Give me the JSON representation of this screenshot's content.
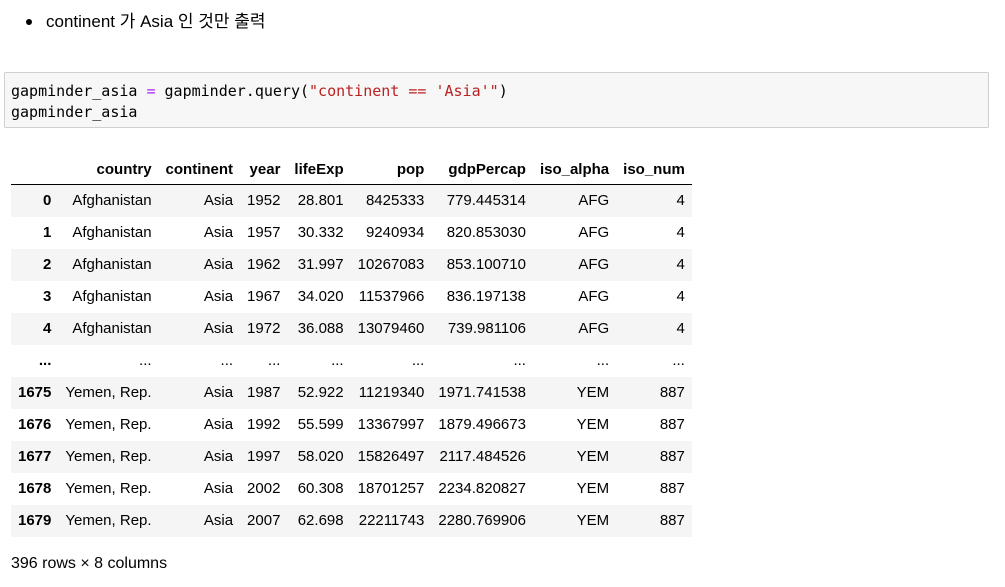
{
  "markdown": {
    "bullet": "continent 가 Asia 인 것만 출력"
  },
  "code_cell": {
    "line1_var": "gapminder_asia",
    "line1_op": " = ",
    "line1_call": "gapminder.query(",
    "line1_str": "\"continent == 'Asia'\"",
    "line1_close": ")",
    "line2": "gapminder_asia"
  },
  "table": {
    "columns": [
      "country",
      "continent",
      "year",
      "lifeExp",
      "pop",
      "gdpPercap",
      "iso_alpha",
      "iso_num"
    ],
    "rows": [
      {
        "index": "0",
        "cells": [
          "Afghanistan",
          "Asia",
          "1952",
          "28.801",
          "8425333",
          "779.445314",
          "AFG",
          "4"
        ]
      },
      {
        "index": "1",
        "cells": [
          "Afghanistan",
          "Asia",
          "1957",
          "30.332",
          "9240934",
          "820.853030",
          "AFG",
          "4"
        ]
      },
      {
        "index": "2",
        "cells": [
          "Afghanistan",
          "Asia",
          "1962",
          "31.997",
          "10267083",
          "853.100710",
          "AFG",
          "4"
        ]
      },
      {
        "index": "3",
        "cells": [
          "Afghanistan",
          "Asia",
          "1967",
          "34.020",
          "11537966",
          "836.197138",
          "AFG",
          "4"
        ]
      },
      {
        "index": "4",
        "cells": [
          "Afghanistan",
          "Asia",
          "1972",
          "36.088",
          "13079460",
          "739.981106",
          "AFG",
          "4"
        ]
      },
      {
        "index": "...",
        "cells": [
          "...",
          "...",
          "...",
          "...",
          "...",
          "...",
          "...",
          "..."
        ]
      },
      {
        "index": "1675",
        "cells": [
          "Yemen, Rep.",
          "Asia",
          "1987",
          "52.922",
          "11219340",
          "1971.741538",
          "YEM",
          "887"
        ]
      },
      {
        "index": "1676",
        "cells": [
          "Yemen, Rep.",
          "Asia",
          "1992",
          "55.599",
          "13367997",
          "1879.496673",
          "YEM",
          "887"
        ]
      },
      {
        "index": "1677",
        "cells": [
          "Yemen, Rep.",
          "Asia",
          "1997",
          "58.020",
          "15826497",
          "2117.484526",
          "YEM",
          "887"
        ]
      },
      {
        "index": "1678",
        "cells": [
          "Yemen, Rep.",
          "Asia",
          "2002",
          "60.308",
          "18701257",
          "2234.820827",
          "YEM",
          "887"
        ]
      },
      {
        "index": "1679",
        "cells": [
          "Yemen, Rep.",
          "Asia",
          "2007",
          "62.698",
          "22211743",
          "2280.769906",
          "YEM",
          "887"
        ]
      }
    ],
    "shape_text": "396 rows × 8 columns"
  },
  "colors": {
    "code_bg": "#f7f7f7",
    "code_border": "#cfcfcf",
    "operator": "#aa22ff",
    "string": "#ba2121",
    "row_stripe": "#f5f5f5"
  }
}
